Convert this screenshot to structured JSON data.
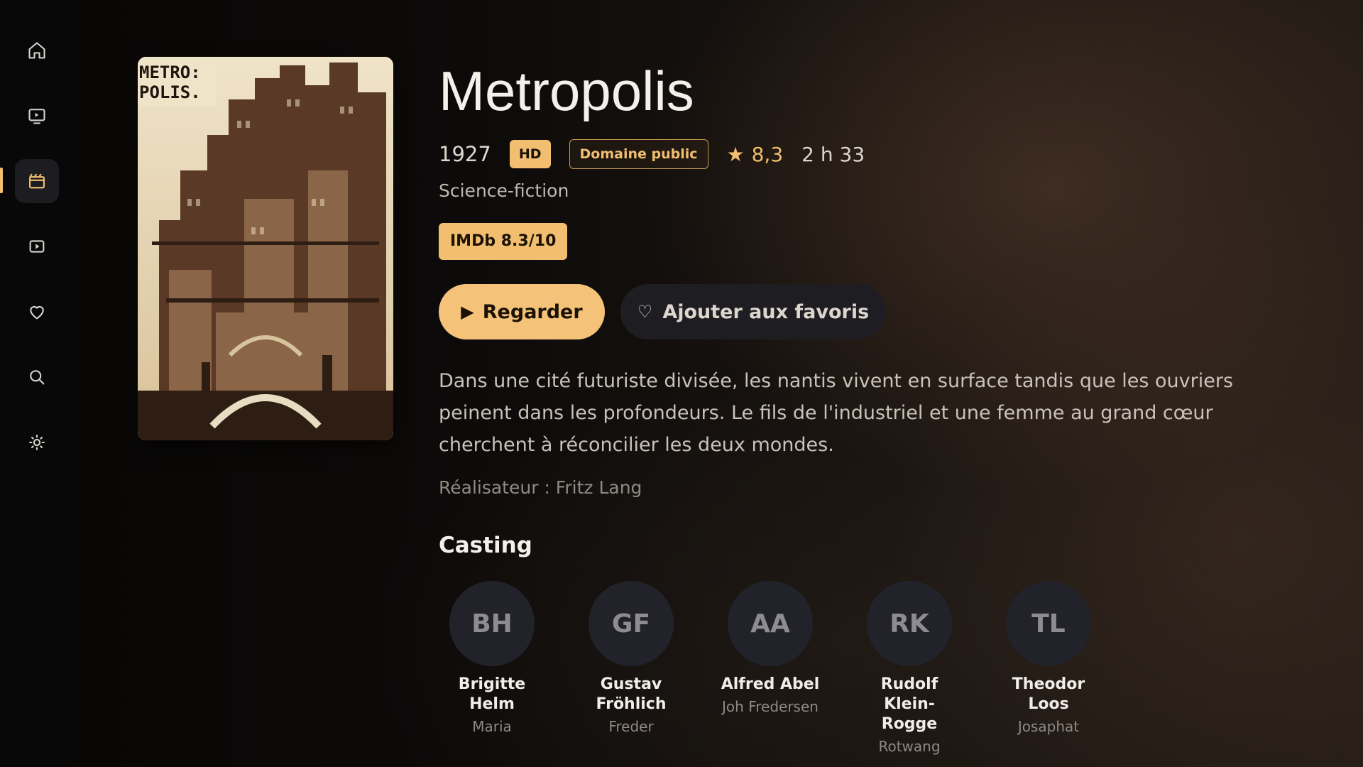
{
  "colors": {
    "accent": "#f2be6f",
    "sidebar_bg": "#080808",
    "button_secondary_bg": "#1e1d21"
  },
  "sidebar": {
    "items": [
      {
        "name": "home",
        "icon": "home-icon",
        "active": false
      },
      {
        "name": "tv",
        "icon": "tv-icon",
        "active": false
      },
      {
        "name": "movies",
        "icon": "film-icon",
        "active": true
      },
      {
        "name": "videos",
        "icon": "play-square-icon",
        "active": false
      },
      {
        "name": "favorites",
        "icon": "heart-icon",
        "active": false
      },
      {
        "name": "search",
        "icon": "search-icon",
        "active": false
      },
      {
        "name": "settings",
        "icon": "brightness-icon",
        "active": false
      }
    ]
  },
  "poster": {
    "text": "METRO-\nPOLIS."
  },
  "movie": {
    "title": "Metropolis",
    "year": "1927",
    "quality": "HD",
    "license": "Domaine public",
    "rating": "8,3",
    "duration": "2 h 33",
    "genre": "Science-fiction",
    "imdb": "IMDb 8.3/10",
    "synopsis": "Dans une cité futuriste divisée, les nantis vivent en surface tandis que les ouvriers peinent dans les profondeurs. Le fils de l'industriel et une femme au grand cœur cherchent à réconcilier les deux mondes.",
    "director": "Réalisateur : Fritz Lang"
  },
  "actions": {
    "play_icon": "▶",
    "watch_label": "Regarder",
    "fav_icon": "♡",
    "favorite_label": "Ajouter aux favoris"
  },
  "casting": {
    "title": "Casting",
    "members": [
      {
        "initials": "BH",
        "name": "Brigitte Helm",
        "role": "Maria"
      },
      {
        "initials": "GF",
        "name": "Gustav Fröhlich",
        "role": "Freder"
      },
      {
        "initials": "AA",
        "name": "Alfred Abel",
        "role": "Joh Fredersen"
      },
      {
        "initials": "RK",
        "name": "Rudolf Klein-Rogge",
        "role": "Rotwang"
      },
      {
        "initials": "TL",
        "name": "Theodor Loos",
        "role": "Josaphat"
      }
    ]
  }
}
